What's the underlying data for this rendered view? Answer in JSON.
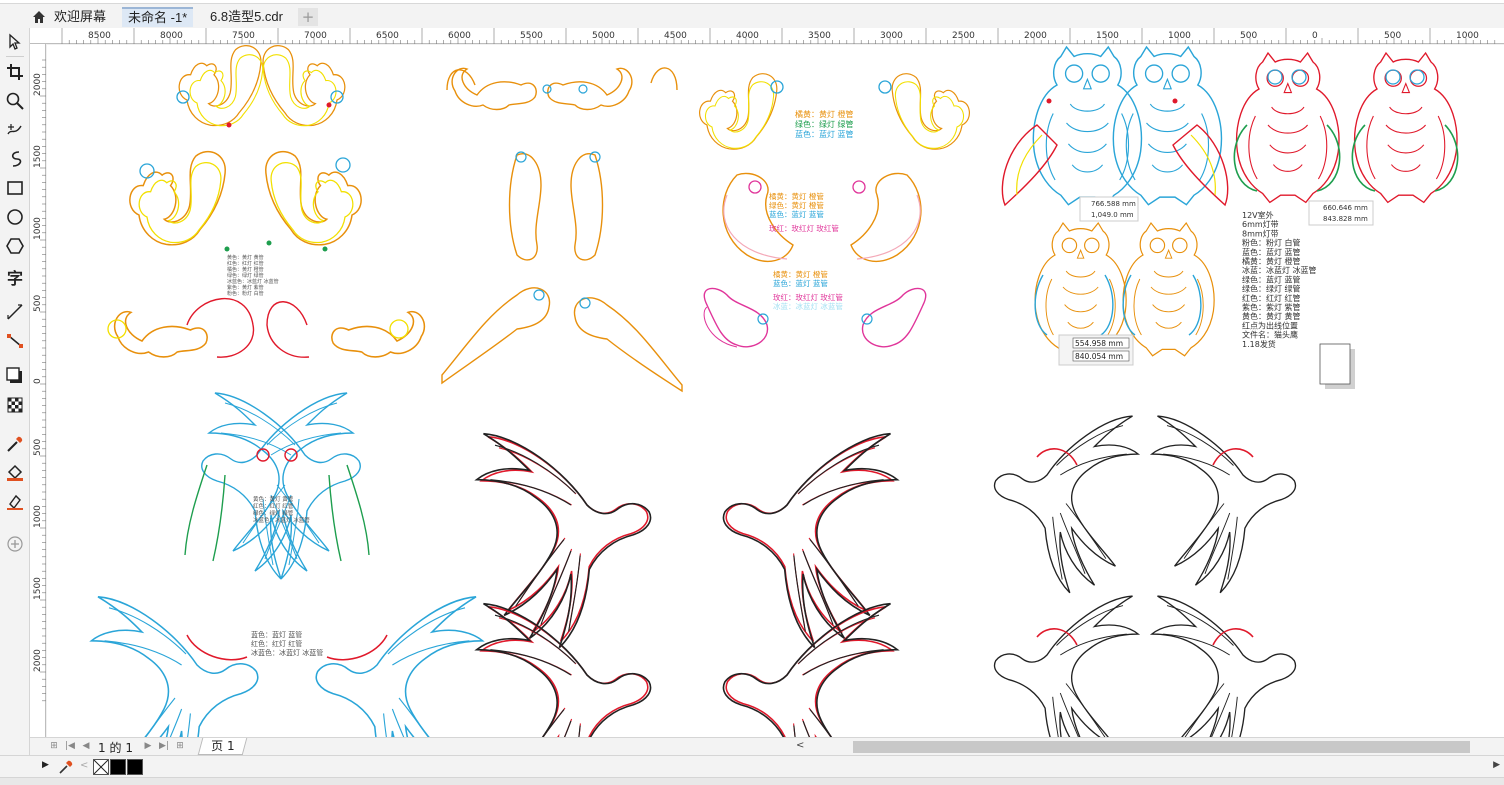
{
  "tabs": [
    {
      "label": "欢迎屏幕",
      "active": false
    },
    {
      "label": "未命名 -1*",
      "active": true
    },
    {
      "label": "6.8造型5.cdr",
      "active": false
    }
  ],
  "add_tab_label": "+",
  "toolbox": [
    "pick-tool-icon",
    "crop-tool-icon",
    "zoom-tool-icon",
    "freehand-tool-icon",
    "artistic-media-icon",
    "rectangle-tool-icon",
    "ellipse-tool-icon",
    "polygon-tool-icon",
    "text-tool-icon",
    "parallel-dimension-icon",
    "connector-tool-icon",
    "drop-shadow-icon",
    "transparency-icon",
    "eyedropper-icon",
    "interactive-fill-icon",
    "smart-fill-icon",
    "add-tool-icon"
  ],
  "text_tool_glyph": "字",
  "ruler_top_labels": [
    "8500",
    "8000",
    "7500",
    "7000",
    "6500",
    "6000",
    "5500",
    "5000",
    "4500",
    "4000",
    "3500",
    "3000",
    "2500",
    "2000",
    "1500",
    "1000",
    "500",
    "0",
    "500",
    "1000"
  ],
  "ruler_left_labels": [
    "2000",
    "1500",
    "1000",
    "500",
    "0",
    "500",
    "1000",
    "1500",
    "2000"
  ],
  "canvas_annotations": {
    "squirrel_notes": [
      "黄色：黄灯 黄管",
      "红色：红灯 红管",
      "橘色：黄灯 橙管",
      "绿色：绿灯 绿管",
      "冰蓝色：冰蓝灯 冰蓝管",
      "紫色：黄灯 紫管",
      "粉色：粉灯 白管"
    ],
    "squirrel_notes_2": [
      "橘黄：黄灯 橙管",
      "绿色：绿灯 绿管",
      "蓝色：蓝灯 蓝管"
    ],
    "squirrel_notes_3": [
      "橘黄：黄灯 橙管",
      "绿色：黄灯 橙管",
      "蓝色：蓝灯 蓝管",
      "玫红：玫红灯 玫红管"
    ],
    "squirrel_notes_4": [
      "橘黄：黄灯 橙管",
      "蓝色：蓝灯 蓝管",
      "玫红：玫红灯 玫红管",
      "冰蓝：冰蓝灯 冰蓝管"
    ],
    "parrot_notes": [
      "黄色：黄灯 黄管",
      "红色：红灯 红管",
      "绿色：绿灯 绿管",
      "冰蓝色：冰蓝灯 冰蓝管"
    ],
    "parrot_notes_2": [
      "蓝色：蓝灯 蓝管",
      "红色：红灯 红管",
      "冰蓝色：冰蓝灯 冰蓝管"
    ],
    "owl_notes": [
      "12V室外",
      "6mm灯带",
      "8mm灯带",
      "粉色：粉灯 白管",
      "蓝色：蓝灯 蓝管",
      "橘黄：黄灯 橙管",
      "冰蓝：冰蓝灯 冰蓝管",
      "绿色：蓝灯 蓝管",
      "绿色：绿灯 绿管",
      "红色：红灯 红管",
      "紫色：紫灯 紫管",
      "黄色：黄灯 黄管",
      "红点为出线位置",
      "文件名：猫头鹰",
      "1.18发货"
    ],
    "dim_owl_1": [
      "766.588 mm",
      "1,049.0 mm"
    ],
    "dim_owl_2": [
      "660.646 mm",
      "843.828 mm"
    ],
    "dim_owl_3": [
      "554.958 mm",
      "840.054 mm"
    ]
  },
  "page_nav": {
    "current": "1",
    "of_label": "的",
    "total": "1",
    "page_tab": "页 1"
  },
  "palette": {
    "colors": [
      "#000000",
      "#000000"
    ],
    "none_label": "none"
  },
  "colors": {
    "orange": "#e8900c",
    "yellow": "#f2e000",
    "cyan": "#2aa5d8",
    "red": "#e0192b",
    "green": "#1e9e4e",
    "pink": "#e0359a",
    "black": "#222222",
    "lightpink": "#f4a9b8"
  }
}
